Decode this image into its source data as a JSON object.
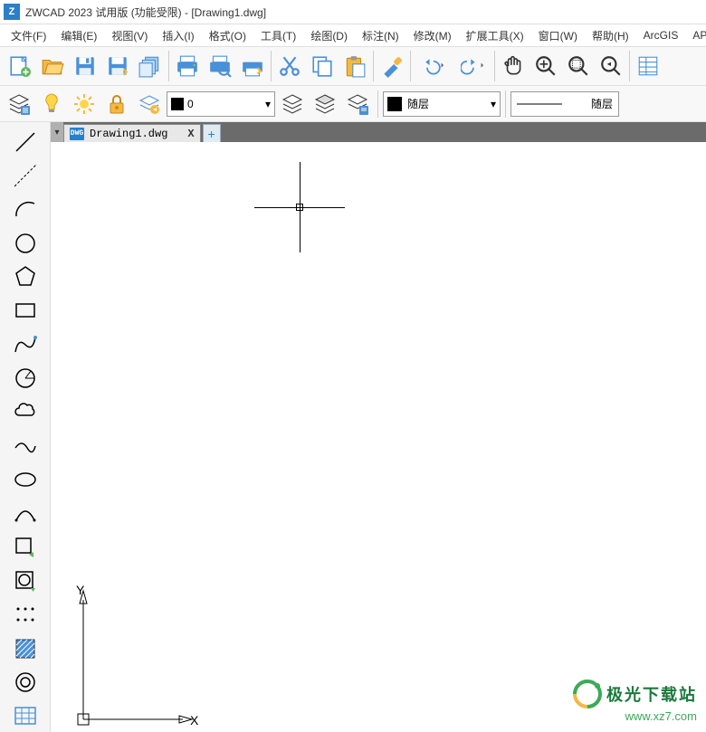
{
  "title": "ZWCAD 2023 试用版 (功能受限) - [Drawing1.dwg]",
  "menu": {
    "file": "文件(F)",
    "edit": "编辑(E)",
    "view": "视图(V)",
    "insert": "插入(I)",
    "format": "格式(O)",
    "tools": "工具(T)",
    "draw": "绘图(D)",
    "dimension": "标注(N)",
    "modify": "修改(M)",
    "ext_tools": "扩展工具(X)",
    "window": "窗口(W)",
    "help": "帮助(H)",
    "arcgis": "ArcGIS",
    "app_plus": "APP+"
  },
  "toolbar_props": {
    "layer_value": "0",
    "color_label": "随层",
    "linetype_label": "随层"
  },
  "tab": {
    "name": "Drawing1.dwg",
    "close": "X",
    "new": "+"
  },
  "ucs": {
    "x_label": "X",
    "y_label": "Y"
  },
  "watermark": {
    "line1": "极光下载站",
    "line2": "www.xz7.com"
  },
  "icons": {
    "new": "new-icon",
    "open": "open-icon",
    "save": "save-icon",
    "saveas": "saveas-icon",
    "batch": "batch-icon",
    "print": "print-icon",
    "preview": "preview-icon",
    "plot": "plot-icon",
    "cut": "cut-icon",
    "copy": "copy-icon",
    "paste": "paste-icon",
    "brush": "brush-icon",
    "undo": "undo-icon",
    "redo": "redo-icon",
    "pan": "pan-icon",
    "zoom": "zoom-icon",
    "zoom2": "zoom-window-icon",
    "zoom3": "zoom-ext-icon",
    "props": "props-icon",
    "layer_mgr": "layer-manager-icon",
    "bulb": "layer-on-icon",
    "freeze": "layer-freeze-icon",
    "lock": "layer-lock-icon",
    "layer_states": "layer-states-icon",
    "layer_prev": "layer-prev-icon",
    "layer_iso": "layer-iso-icon",
    "layer_props": "layer-props-icon"
  }
}
